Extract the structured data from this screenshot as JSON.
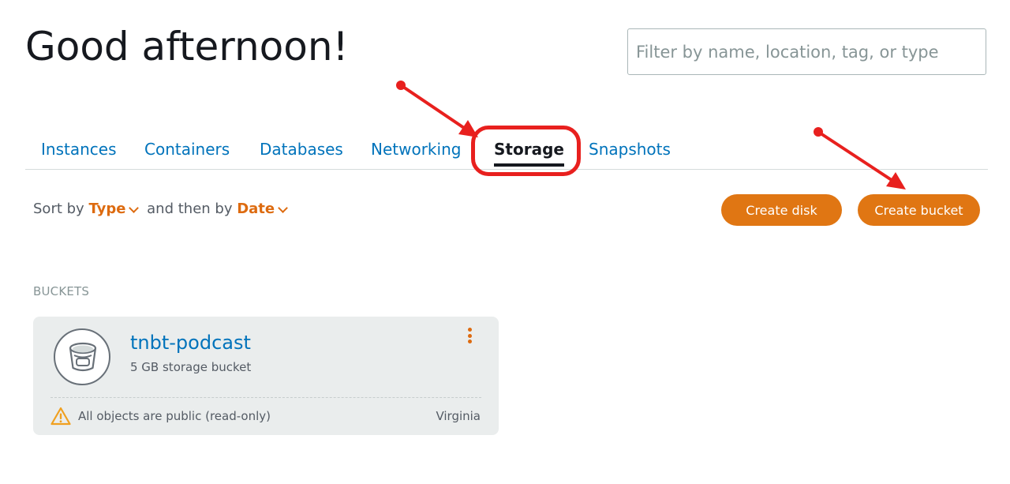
{
  "header": {
    "greeting": "Good afternoon!",
    "filter_placeholder": "Filter by name, location, tag, or type"
  },
  "tabs": [
    {
      "label": "Instances",
      "active": false
    },
    {
      "label": "Containers",
      "active": false
    },
    {
      "label": "Databases",
      "active": false
    },
    {
      "label": "Networking",
      "active": false
    },
    {
      "label": "Storage",
      "active": true
    },
    {
      "label": "Snapshots",
      "active": false
    }
  ],
  "sort": {
    "prefix": "Sort by",
    "primary": "Type",
    "middle": "and then by",
    "secondary": "Date"
  },
  "actions": {
    "create_disk": "Create disk",
    "create_bucket": "Create bucket"
  },
  "buckets_section": {
    "label": "BUCKETS",
    "items": [
      {
        "name": "tnbt-podcast",
        "description": "5 GB storage bucket",
        "access_warning": "All objects are public (read-only)",
        "region": "Virginia",
        "icon": "bucket-icon"
      }
    ]
  },
  "colors": {
    "accent_orange": "#e07613",
    "link_blue": "#0073bb",
    "annotation_red": "#e8201e"
  }
}
